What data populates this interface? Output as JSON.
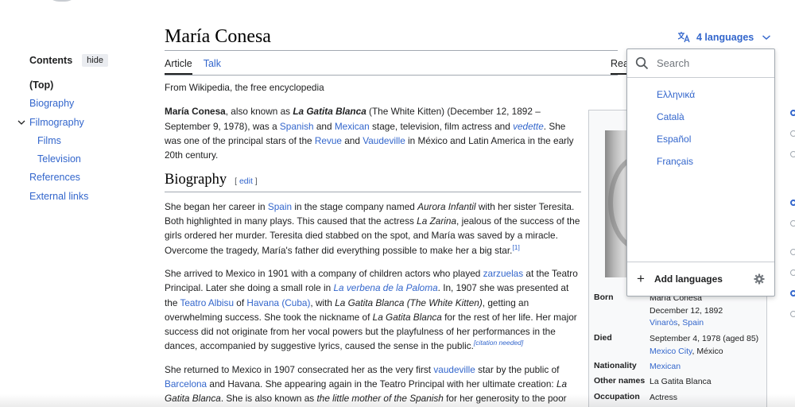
{
  "page": {
    "title": "María Conesa",
    "tagline": "From Wikipedia, the free encyclopedia"
  },
  "toc": {
    "title": "Contents",
    "hide_label": "hide",
    "items": [
      {
        "label": "(Top)"
      },
      {
        "label": "Biography"
      },
      {
        "label": "Filmography"
      },
      {
        "label": "Films"
      },
      {
        "label": "Television"
      },
      {
        "label": "References"
      },
      {
        "label": "External links"
      }
    ]
  },
  "tabs": {
    "article": "Article",
    "talk": "Talk",
    "read_fragment": "Rea"
  },
  "languages": {
    "button_label": "4 languages",
    "search_placeholder": "Search",
    "items": [
      "Ελληνικά",
      "Català",
      "Español",
      "Français"
    ],
    "add_label": "Add languages"
  },
  "content": {
    "intro": {
      "name": "María Conesa",
      "t1": ", also known as ",
      "nick": "La Gatita Blanca",
      "t2": " (The White Kitten) (December 12, 1892 – September 9, 1978), was a ",
      "link_spanish": "Spanish",
      "t3": " and ",
      "link_mexican": "Mexican",
      "t4": " stage, television, film actress and ",
      "link_vedette": "vedette",
      "t5": ". She was one of the principal stars of the ",
      "link_revue": "Revue",
      "t6": " and ",
      "link_vaudeville": "Vaudeville",
      "t7": " in México and Latin America in the early 20th century."
    },
    "biography_heading": "Biography",
    "edit_label": "edit",
    "edit_open": "[ ",
    "edit_close": " ]",
    "p1": {
      "t1": "She began her career in ",
      "link_spain": "Spain",
      "t2": " in the stage company named ",
      "aurora": "Aurora Infantil",
      "t3": " with her sister Teresita. Both highlighted in many plays. This caused that the actress ",
      "zarina": "La Zarina",
      "t4": ", jealous of the success of the girls ordered her murder. Teresita died stabbed on the spot, and María was saved by a miracle. Overcome the tragedy, María's father did everything possible to make her a big star.",
      "ref": "[1]"
    },
    "p2": {
      "t1": "She arrived to Mexico in 1901 with a company of children actors who played ",
      "link_zarzuelas": "zarzuelas",
      "t2": " at the Teatro Principal. Later she doing a small role in ",
      "link_verbena": "La verbena de la Paloma",
      "t3": ". In, 1907 she was presented at the ",
      "link_albisu": "Teatro Albisu",
      "t4": " of ",
      "link_havana": "Havana (Cuba)",
      "t5": ", with ",
      "gatita_full": "La Gatita Blanca (The White Kitten)",
      "t6": ", getting an overwhelming success. She took the nickname of ",
      "gatita": "La Gatita Blanca",
      "t7": " for the rest of her life. Her major success did not originate from her vocal powers but the playfulness of her performances in the dances, accompanied by suggestive lyrics, caused the sense in the public.",
      "citation": "[citation needed]"
    },
    "p3": {
      "t1": "She returned to Mexico in 1907 consecrated her as the very first ",
      "link_vaudeville": "vaudeville",
      "t2": " star by the public of ",
      "link_barcelona": "Barcelona",
      "t3": " and Havana. She appearing again in the Teatro Principal with her ultimate creation: ",
      "la": "La",
      "gatita2": "Gatita Blanca",
      "t4": ". She is also known as ",
      "little": "the little mother of the Spanish",
      "t5": " for her generosity to the poor"
    }
  },
  "infobox": {
    "born_label": "Born",
    "born_name": "María Conesa",
    "born_date": "December 12, 1892",
    "born_place_1": "Vinaròs",
    "born_sep": ", ",
    "born_place_2": "Spain",
    "died_label": "Died",
    "died_date": "September 4, 1978 (aged 85)",
    "died_place_1": "Mexico City",
    "died_place_2": ", México",
    "nationality_label": "Nationality",
    "nationality": "Mexican",
    "other_names_label": "Other names",
    "other_names": "La Gatita Blanca",
    "occupation_label": "Occupation",
    "occupation": "Actress"
  }
}
